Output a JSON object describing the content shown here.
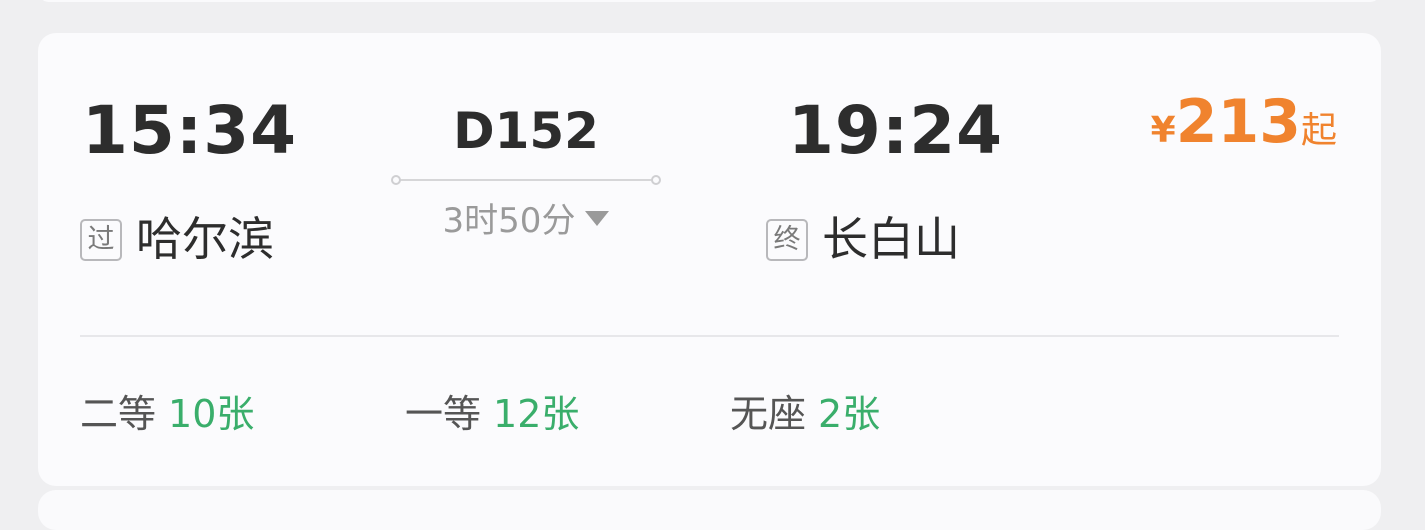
{
  "train": {
    "departure_time": "15:34",
    "arrival_time": "19:24",
    "train_number": "D152",
    "duration": "3时50分",
    "departure_badge": "过",
    "departure_station": "哈尔滨",
    "arrival_badge": "终",
    "arrival_station": "长白山",
    "price_currency": "¥",
    "price_amount": "213",
    "price_suffix": "起"
  },
  "seats": [
    {
      "class": "二等",
      "count": "10张"
    },
    {
      "class": "一等",
      "count": "12张"
    },
    {
      "class": "无座",
      "count": "2张"
    }
  ],
  "colors": {
    "price": "#f0832e",
    "availability": "#3aae6b",
    "primary_text": "#2d2d2d"
  }
}
